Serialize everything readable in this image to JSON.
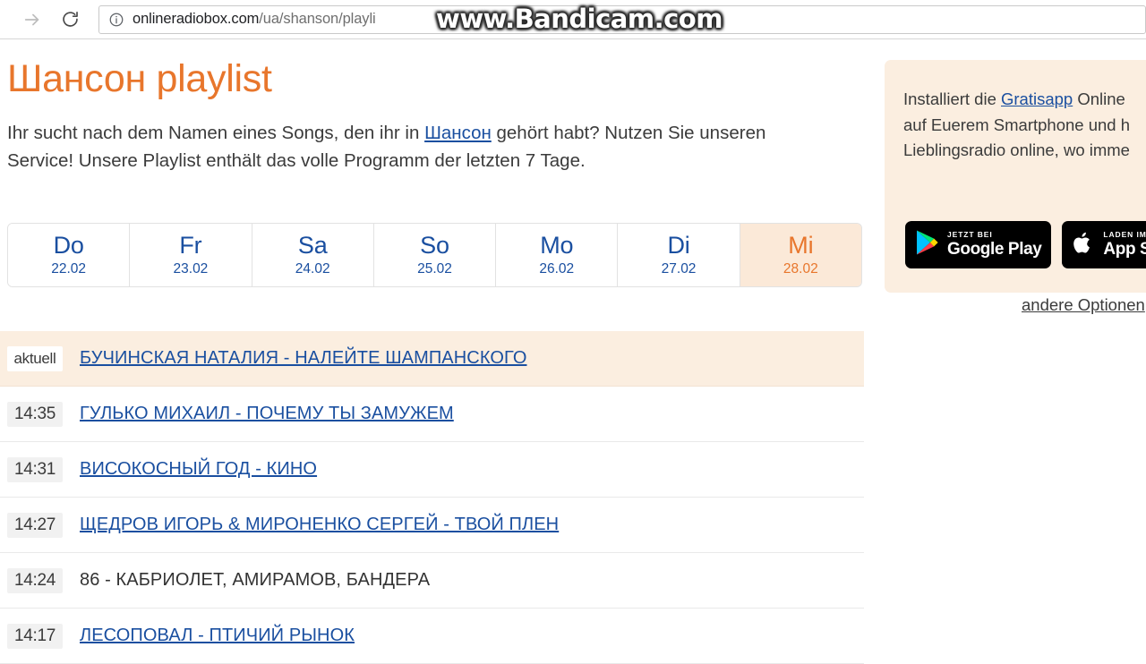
{
  "browser": {
    "forward_icon": "arrow-forward-icon",
    "reload_icon": "reload-icon",
    "info_icon": "page-info-icon",
    "url_domain": "onlineradiobox.com",
    "url_path": "/ua/shanson/playli"
  },
  "watermark": {
    "text": "www.Bandicam.com"
  },
  "page": {
    "title": "Шансон playlist",
    "intro_part1": "Ihr sucht nach dem Namen eines Songs, den ihr in ",
    "intro_link": "Шансон",
    "intro_part2": " gehört habt? Nutzen Sie unseren Service! Unsere Playlist enthält das volle Programm der letzten 7 Tage."
  },
  "day_tabs": [
    {
      "dow": "Do",
      "date": "22.02",
      "active": false
    },
    {
      "dow": "Fr",
      "date": "23.02",
      "active": false
    },
    {
      "dow": "Sa",
      "date": "24.02",
      "active": false
    },
    {
      "dow": "So",
      "date": "25.02",
      "active": false
    },
    {
      "dow": "Mo",
      "date": "26.02",
      "active": false
    },
    {
      "dow": "Di",
      "date": "27.02",
      "active": false
    },
    {
      "dow": "Mi",
      "date": "28.02",
      "active": true
    }
  ],
  "playlist": [
    {
      "time": "aktuell",
      "track": "БУЧИНСКАЯ НАТАЛИЯ - НАЛЕЙТЕ ШАМПАНСКОГО",
      "current": true,
      "is_link": true
    },
    {
      "time": "14:35",
      "track": "ГУЛЬКО МИХАИЛ - ПОЧЕМУ ТЫ ЗАМУЖЕМ",
      "current": false,
      "is_link": true
    },
    {
      "time": "14:31",
      "track": "ВИСОКОСНЫЙ ГОД - КИНО",
      "current": false,
      "is_link": true
    },
    {
      "time": "14:27",
      "track": "ЩЕДРОВ ИГОРЬ & МИРОНЕНКО СЕРГЕЙ - ТВОЙ ПЛЕН",
      "current": false,
      "is_link": true
    },
    {
      "time": "14:24",
      "track": "86 - КАБРИОЛЕТ, АМИРАМОВ, БАНДЕРА",
      "current": false,
      "is_link": false
    },
    {
      "time": "14:17",
      "track": "ЛЕСОПОВАЛ - ПТИЧИЙ РЫНОК",
      "current": false,
      "is_link": true
    }
  ],
  "sidebar": {
    "promo_line1_a": "Installiert die ",
    "promo_link": "Gratisapp",
    "promo_line1_b": " Online",
    "promo_line2": "auf Euerem Smartphone und h",
    "promo_line3": "Lieblingsradio online, wo imme",
    "google_badge": {
      "small": "JETZT BEI",
      "big": "Google Play",
      "icon": "google-play-icon"
    },
    "apple_badge": {
      "small": "LADEN IM",
      "big": "App Store",
      "icon": "apple-icon"
    },
    "other_options": "andere Optionen"
  },
  "colors": {
    "accent_orange": "#e8762c",
    "link_blue": "#1a4fa0",
    "panel_peach": "#fbeee0"
  }
}
